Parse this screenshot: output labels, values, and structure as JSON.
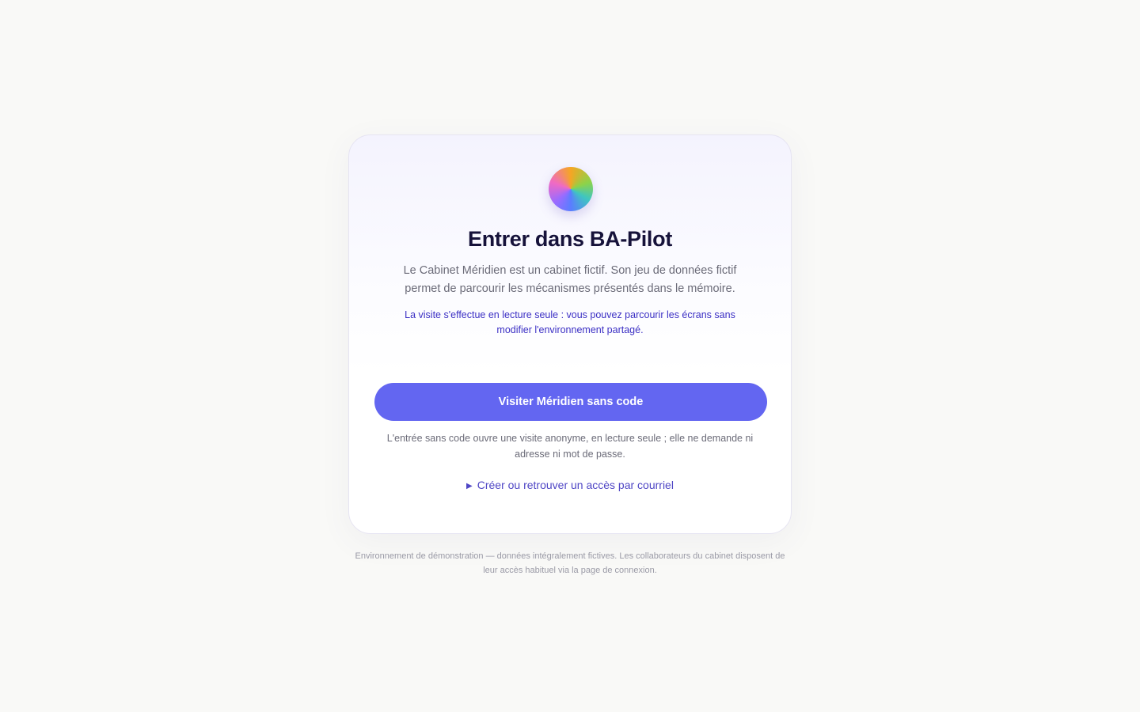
{
  "card": {
    "title": "Entrer dans BA-Pilot",
    "description": "Le Cabinet Méridien est un cabinet fictif. Son jeu de données fictif permet de parcourir les mécanismes présentés dans le mémoire.",
    "notice": "La visite s'effectue en lecture seule : vous pouvez parcourir les écrans sans modifier l'environnement partagé.",
    "visit_button_label": "Visiter Méridien sans code",
    "help_text": "L'entrée sans code ouvre une visite anonyme, en lecture seule ; elle ne demande ni adresse ni mot de passe.",
    "email_access_icon": "▶",
    "email_access_label": "Créer ou retrouver un accès par courriel"
  },
  "footer": {
    "text": "Environnement de démonstration — données intégralement fictives. Les collaborateurs du cabinet disposent de leur accès habituel via la page de connexion."
  },
  "colors": {
    "accent": "#6366f1",
    "notice": "#3b2fc4",
    "link": "#4f46c5",
    "title": "#16123a"
  },
  "icons": {
    "logo": "gradient-circle-logo",
    "disclosure": "triangle-right-icon"
  }
}
